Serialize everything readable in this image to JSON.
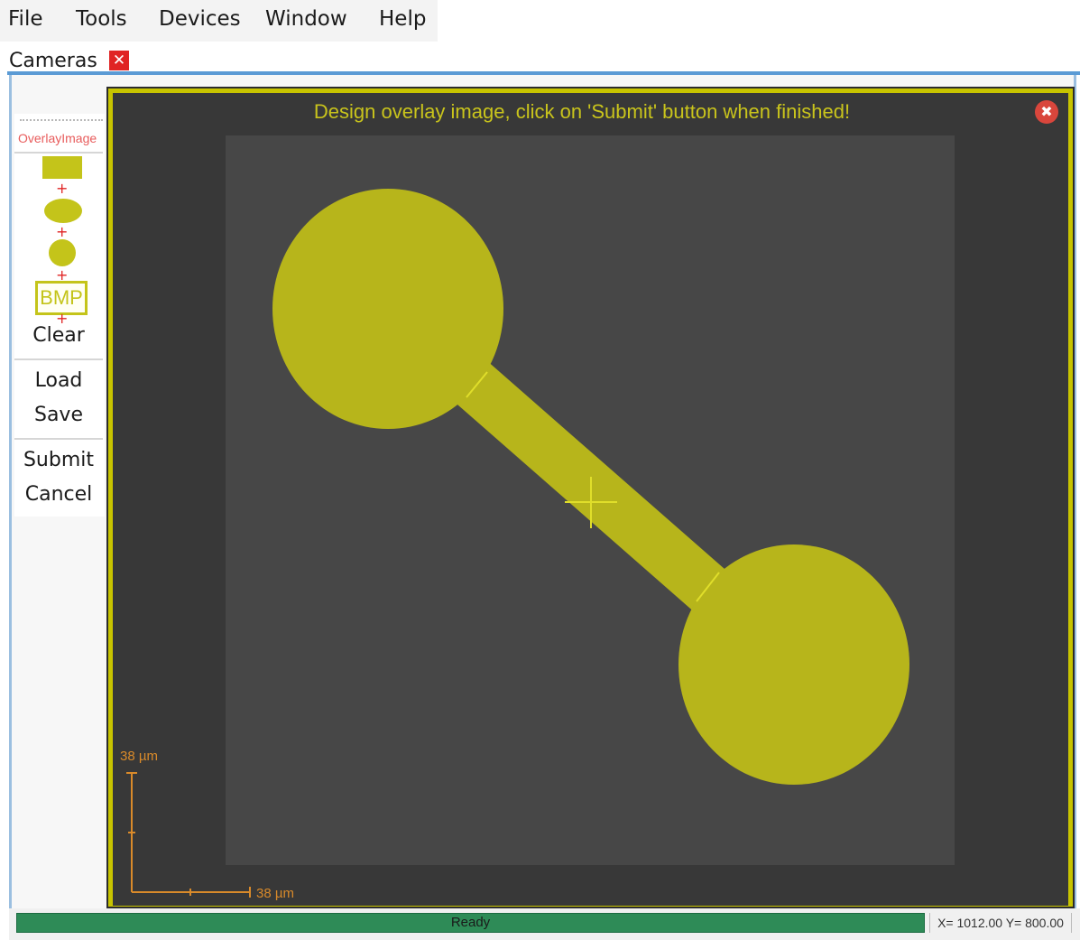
{
  "menu": {
    "items": [
      {
        "label": "File"
      },
      {
        "label": "Tools"
      },
      {
        "label": "Devices"
      },
      {
        "label": "Window"
      },
      {
        "label": "Help"
      }
    ]
  },
  "tab": {
    "label": "Cameras",
    "close_icon": "close-icon"
  },
  "toolbar": {
    "title": "OverlayImage",
    "shapes": [
      {
        "name": "rectangle-tool",
        "icon": "rectangle-icon"
      },
      {
        "name": "ellipse-tool",
        "icon": "ellipse-icon"
      },
      {
        "name": "circle-tool",
        "icon": "circle-icon"
      },
      {
        "name": "bmp-tool",
        "label": "BMP"
      }
    ],
    "plus_glyph": "+",
    "clear_label": "Clear",
    "load_label": "Load",
    "save_label": "Save",
    "submit_label": "Submit",
    "cancel_label": "Cancel"
  },
  "canvas": {
    "instruction": "Design overlay image, click on 'Submit' button when finished!",
    "close_glyph": "✖",
    "scale_y_label": "38 µm",
    "scale_x_label": "38 µm"
  },
  "status": {
    "progress_text": "Ready",
    "progress_value": 1.0,
    "coordinates": "X= 1012.00 Y= 800.00"
  },
  "colors": {
    "overlay": "#b7b51b",
    "accent_yellow": "#c8c400",
    "canvas_bg": "#383838",
    "drawing_bg": "#474747",
    "progress_green": "#2e8b57",
    "scale_orange": "#d98a2a",
    "tab_close_red": "#e02424"
  }
}
